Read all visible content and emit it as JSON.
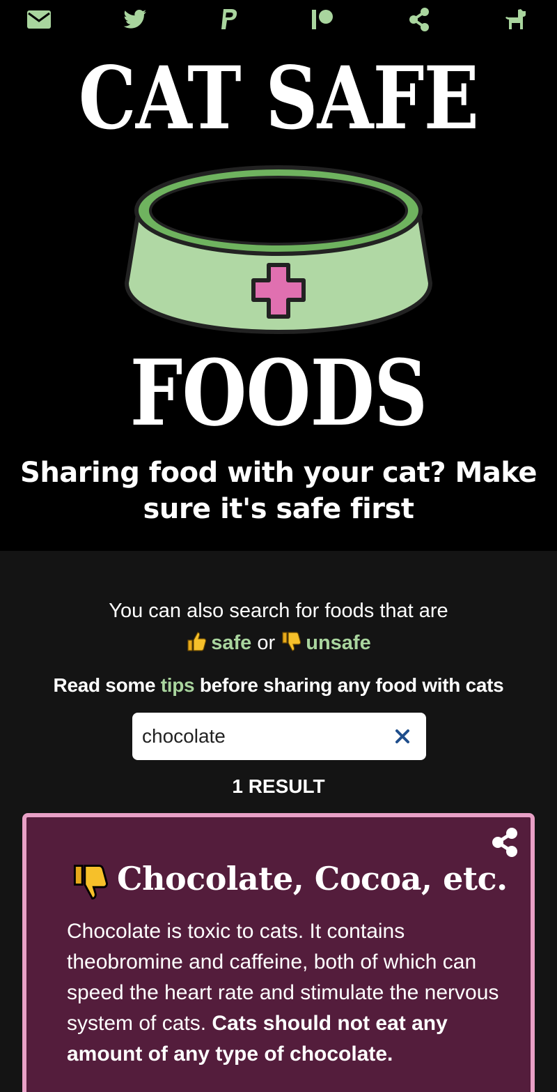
{
  "nav": {
    "icons": [
      "envelope-icon",
      "twitter-icon",
      "paypal-icon",
      "patreon-icon",
      "share-icon",
      "dog-icon"
    ],
    "icon_color": "#a9d59e"
  },
  "hero": {
    "title_line1": "CAT SAFE",
    "title_line2": "FOODS",
    "tagline": "Sharing food with your cat? Make sure it's safe first",
    "bowl_color": "#b0d8a4",
    "cross_color": "#e070b0"
  },
  "search_intro": {
    "line1": "You can also search for foods that are",
    "safe_label": "safe",
    "or_text": "or",
    "unsafe_label": "unsafe"
  },
  "tips": {
    "before": "Read some",
    "link": "tips",
    "after": "before sharing any food with cats"
  },
  "search": {
    "value": "chocolate",
    "clear_icon": "close-icon"
  },
  "results": {
    "count_label": "1 RESULT"
  },
  "result_card": {
    "title": "Chocolate, Cocoa, etc.",
    "verdict_icon": "thumbs-down-icon",
    "body_plain": "Chocolate is toxic to cats. It contains theobromine and caffeine, both of which can speed the heart rate and stimulate the nervous system of cats.",
    "body_bold": "Cats should not eat any amount of any type of chocolate.",
    "border_color": "#e8a0c6",
    "background_color": "#541d3c"
  }
}
